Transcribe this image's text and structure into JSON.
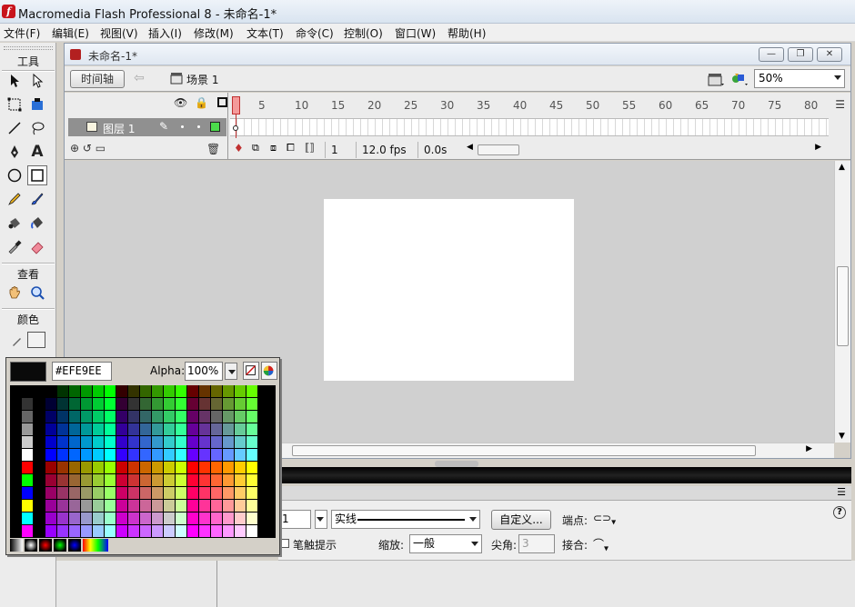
{
  "window": {
    "title": "Macromedia Flash Professional 8 - 未命名-1*"
  },
  "menu": [
    "文件(F)",
    "编辑(E)",
    "视图(V)",
    "插入(I)",
    "修改(M)",
    "文本(T)",
    "命令(C)",
    "控制(O)",
    "窗口(W)",
    "帮助(H)"
  ],
  "tools": {
    "header": "工具",
    "view_label": "查看",
    "color_label": "颜色",
    "items": [
      "selection-icon",
      "subselection-icon",
      "free-transform-icon",
      "gradient-transform-icon",
      "line-icon",
      "lasso-icon",
      "pen-icon",
      "text-icon",
      "oval-icon",
      "rectangle-icon",
      "pencil-icon",
      "brush-icon",
      "ink-bottle-icon",
      "paint-bucket-icon",
      "eyedropper-icon",
      "eraser-icon",
      "hand-icon",
      "zoom-icon"
    ]
  },
  "document": {
    "title": "未命名-1*",
    "timeline_button": "时间轴",
    "scene": "场景 1",
    "zoom": "50%"
  },
  "timeline": {
    "layer_name": "图层 1",
    "ruler": [
      "1",
      "5",
      "10",
      "15",
      "20",
      "25",
      "30",
      "35",
      "40",
      "45",
      "50",
      "55",
      "60",
      "65",
      "70",
      "75",
      "80"
    ],
    "current_frame": "1",
    "frame_rate": "12.0 fps",
    "elapsed": "0.0s"
  },
  "swatch": {
    "hex": "#EFE9EE",
    "alpha_label": "Alpha:",
    "alpha_value": "100%",
    "preview_color": "#0a0a0a"
  },
  "properties": {
    "stroke_size": "1",
    "stroke_style": "实线",
    "custom_button": "自定义...",
    "cap_label": "端点:",
    "scale_label": "缩放:",
    "scale_value": "一般",
    "miter_label": "尖角:",
    "miter_value": "3",
    "join_label": "接合:",
    "hinting_label": "笔触提示"
  },
  "colors": {
    "stage": "#ffffff",
    "workspace": "#d0d0d0",
    "layer_highlight": "#909090",
    "playhead": "#f49a9a"
  }
}
